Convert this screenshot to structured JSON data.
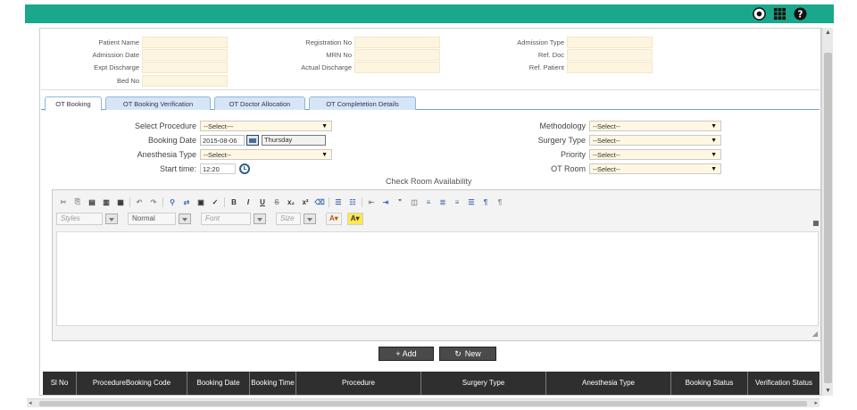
{
  "topbar": {
    "color": "#1aa88c",
    "icons": [
      "eye-icon",
      "grid-icon",
      "help-icon"
    ]
  },
  "patient": {
    "patient_name": "Patient Name",
    "admission_date": "Admission Date",
    "expt_discharge": "Expt Discharge",
    "bed_no": "Bed No",
    "registration_no": "Registration No",
    "mrn_no": "MRN No",
    "actual_discharge": "Actual Discharge",
    "admission_type": "Admission Type",
    "ref_doc": "Ref. Doc",
    "ref_patient": "Ref. Patient"
  },
  "tabs": [
    "OT Booking",
    "OT Booking Verification",
    "OT Doctor Allocation",
    "OT Completetion Details"
  ],
  "form": {
    "select_procedure_label": "Select Procedure",
    "select_procedure_value": "--Select---",
    "booking_date_label": "Booking Date",
    "booking_date_value": "2015-08-06",
    "booking_day_value": "Thursday",
    "anesthesia_type_label": "Anesthesia Type",
    "anesthesia_type_value": "--Select--",
    "start_time_label": "Start time:",
    "start_time_value": "12:20",
    "methodology_label": "Methodology",
    "methodology_value": "--Select--",
    "surgery_type_label": "Surgery Type",
    "surgery_type_value": "--Select--",
    "priority_label": "Priority",
    "priority_value": "--Select--",
    "ot_room_label": "OT Room",
    "ot_room_value": "--Select--",
    "check_room": "Check Room Availability"
  },
  "editor": {
    "styles": "Styles",
    "format": "Normal",
    "font": "Font",
    "size": "Size"
  },
  "buttons": {
    "add": "+ Add",
    "new": "New"
  },
  "grid": {
    "columns": [
      "Sl No",
      "ProcedureBooking Code",
      "Booking Date",
      "Booking Time",
      "Procedure",
      "Surgery Type",
      "Anesthesia Type",
      "Booking Status",
      "Verification Status"
    ]
  }
}
